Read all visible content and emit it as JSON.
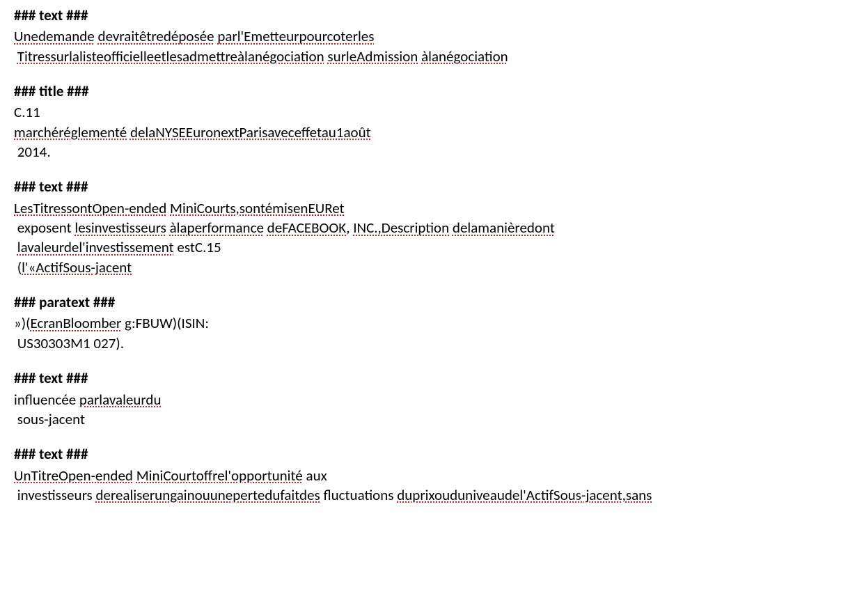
{
  "sections": [
    {
      "marker": "### text ###",
      "lines": [
        {
          "segments": [
            {
              "t": "Unedemande",
              "u": true
            },
            {
              "t": " ",
              "u": false
            },
            {
              "t": "devraitêtredéposée",
              "u": true
            },
            {
              "t": " ",
              "u": false
            },
            {
              "t": "parl'Emetteurpourcoterles",
              "u": true
            }
          ]
        },
        {
          "segments": [
            {
              "t": " ",
              "u": false
            },
            {
              "t": "Titressurlalisteofficielleetlesadmettreàlanégociation",
              "u": true
            },
            {
              "t": " ",
              "u": false
            },
            {
              "t": "surleAdmission",
              "u": true
            },
            {
              "t": " ",
              "u": false
            },
            {
              "t": "àlanégociation",
              "u": true
            }
          ]
        }
      ]
    },
    {
      "marker": "### title ###",
      "lines": [
        {
          "segments": [
            {
              "t": "C.11",
              "u": false
            }
          ]
        },
        {
          "segments": [
            {
              "t": "marchéréglementé",
              "u": true
            },
            {
              "t": " ",
              "u": false
            },
            {
              "t": "delaNYSEEuronextParisaveceffetau1août",
              "u": true
            }
          ]
        },
        {
          "segments": [
            {
              "t": " 2014.",
              "u": false
            }
          ]
        }
      ]
    },
    {
      "marker": "### text ###",
      "lines": [
        {
          "segments": [
            {
              "t": "LesTitressontOpen-ended",
              "u": true
            },
            {
              "t": " ",
              "u": false
            },
            {
              "t": "MiniCourts,sontémisenEURet",
              "u": true
            }
          ]
        },
        {
          "segments": [
            {
              "t": " exposent ",
              "u": false
            },
            {
              "t": "lesinvestisseurs",
              "u": true
            },
            {
              "t": " ",
              "u": false
            },
            {
              "t": "àlaperformance",
              "u": true
            },
            {
              "t": " ",
              "u": false
            },
            {
              "t": "deFACEBOOK",
              "u": true
            },
            {
              "t": ", ",
              "u": false
            },
            {
              "t": "INC.,Description",
              "u": true
            },
            {
              "t": " ",
              "u": false
            },
            {
              "t": "delamanièredont",
              "u": true
            }
          ]
        },
        {
          "segments": [
            {
              "t": " ",
              "u": false
            },
            {
              "t": "lavaleurdel'investissement",
              "u": true
            },
            {
              "t": " estC.15",
              "u": false
            }
          ]
        },
        {
          "segments": [
            {
              "t": " (",
              "u": false
            },
            {
              "t": "l'«ActifSous-jacent",
              "u": true
            }
          ]
        }
      ]
    },
    {
      "marker": "### paratext ###",
      "lines": [
        {
          "segments": [
            {
              "t": "»)(",
              "u": false
            },
            {
              "t": "EcranBloomber",
              "u": true
            },
            {
              "t": " g:FBUW)(ISIN:",
              "u": false
            }
          ]
        },
        {
          "segments": [
            {
              "t": " US30303M1 027).",
              "u": false
            }
          ]
        }
      ]
    },
    {
      "marker": "### text ###",
      "lines": [
        {
          "segments": [
            {
              "t": "influencée ",
              "u": false
            },
            {
              "t": "parlavaleurdu",
              "u": true
            }
          ]
        },
        {
          "segments": [
            {
              "t": " sous-jacent",
              "u": false
            }
          ]
        }
      ]
    },
    {
      "marker": "### text ###",
      "lines": [
        {
          "segments": [
            {
              "t": "UnTitreOpen-ended",
              "u": true
            },
            {
              "t": " ",
              "u": false
            },
            {
              "t": "MiniCourtoffrel'opportunité",
              "u": true
            },
            {
              "t": " aux",
              "u": false
            }
          ]
        },
        {
          "segments": [
            {
              "t": " investisseurs ",
              "u": false
            },
            {
              "t": "derealiserungainouunepertedufaitdes",
              "u": true
            },
            {
              "t": " fluctuations ",
              "u": false
            },
            {
              "t": "duprixouduniveaudel'ActifSous-jacent,sans",
              "u": true
            }
          ]
        }
      ]
    }
  ]
}
